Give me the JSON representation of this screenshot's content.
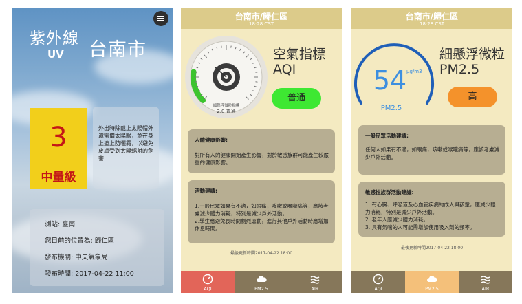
{
  "screen1": {
    "title": "紫外線",
    "subtitle": "UV",
    "city": "台南市",
    "uv_value": "3",
    "uv_level": "中量級",
    "advice": "外出時除戴上太陽帽外還需備太陽眼，並在身上塗上防曬霜，以避免皮膚受到太陽輻射的危害",
    "station": "測站: 臺南",
    "location": "您目前的位置為: 歸仁區",
    "publisher": "發布機關: 中央氣象局",
    "publish_time": "發布時間: 2017-04-22 11:00",
    "uv_box_color": "#f2cf1b",
    "uv_text_color": "#c41717"
  },
  "screen2": {
    "header_city": "台南市/歸仁區",
    "header_time": "18:28 CST",
    "gauge_label": "細懸浮微粒指標",
    "gauge_value": "2.0 普通",
    "gauge_level": 0.2,
    "title_cn": "空氣指標",
    "title_en": "AQI",
    "status": "普通",
    "status_color": "#3ee832",
    "health_title": "人體健康影響:",
    "health_body": "對所有人的健康開始產生影響，對於敏感族群可能產生較嚴重的健康影響。",
    "activity_title": "活動建議:",
    "activity_body": "1.一般民眾如果有不適，如眼痛，咳嗽或喉嚨痛等，應該考慮減少體力消耗，特別是減少戶外活動。\n2.學生應避免長時間劇烈運動，進行其他戶外活動時應增加休息時間。",
    "updated": "最後更新時間2017-04-22 18:00",
    "nav": [
      {
        "label": "AQI",
        "icon": "gauge-icon",
        "active": true
      },
      {
        "label": "PM2.5",
        "icon": "cloud-icon",
        "active": false
      },
      {
        "label": "AIR",
        "icon": "wind-icon",
        "active": false
      }
    ],
    "active_color": "#e26559"
  },
  "screen3": {
    "header_city": "台南市/歸仁區",
    "header_time": "18:28 CST",
    "pm_value": "54",
    "pm_unit": "μg/m3",
    "pm_label": "PM2.5",
    "title_cn": "細懸浮微粒",
    "title_en": "PM2.5",
    "status": "高",
    "status_color": "#f4922b",
    "general_title": "一般民眾活動建議:",
    "general_body": "任何人如果有不適，如眼痛，咳嗽或喉嚨痛等，應該考慮減少戶外活動。",
    "sensitive_title": "敏感性族群活動建議:",
    "sensitive_body": "1. 有心臟、呼吸道及心血管疾病的成人與孩童，應減少體力消耗，特別是減少戶外活動。\n2. 老年人應減少體力消耗。\n3. 具有氣喘的人可能需增加使用吸入劑的頻率。",
    "updated": "最後更新時間2017-04-22 18:00",
    "nav": [
      {
        "label": "AQI",
        "icon": "gauge-icon",
        "active": false
      },
      {
        "label": "PM2.5",
        "icon": "cloud-icon",
        "active": true
      },
      {
        "label": "AIR",
        "icon": "wind-icon",
        "active": false
      }
    ],
    "active_color": "#f4c07a",
    "ring_color": "#1f5fb8"
  }
}
